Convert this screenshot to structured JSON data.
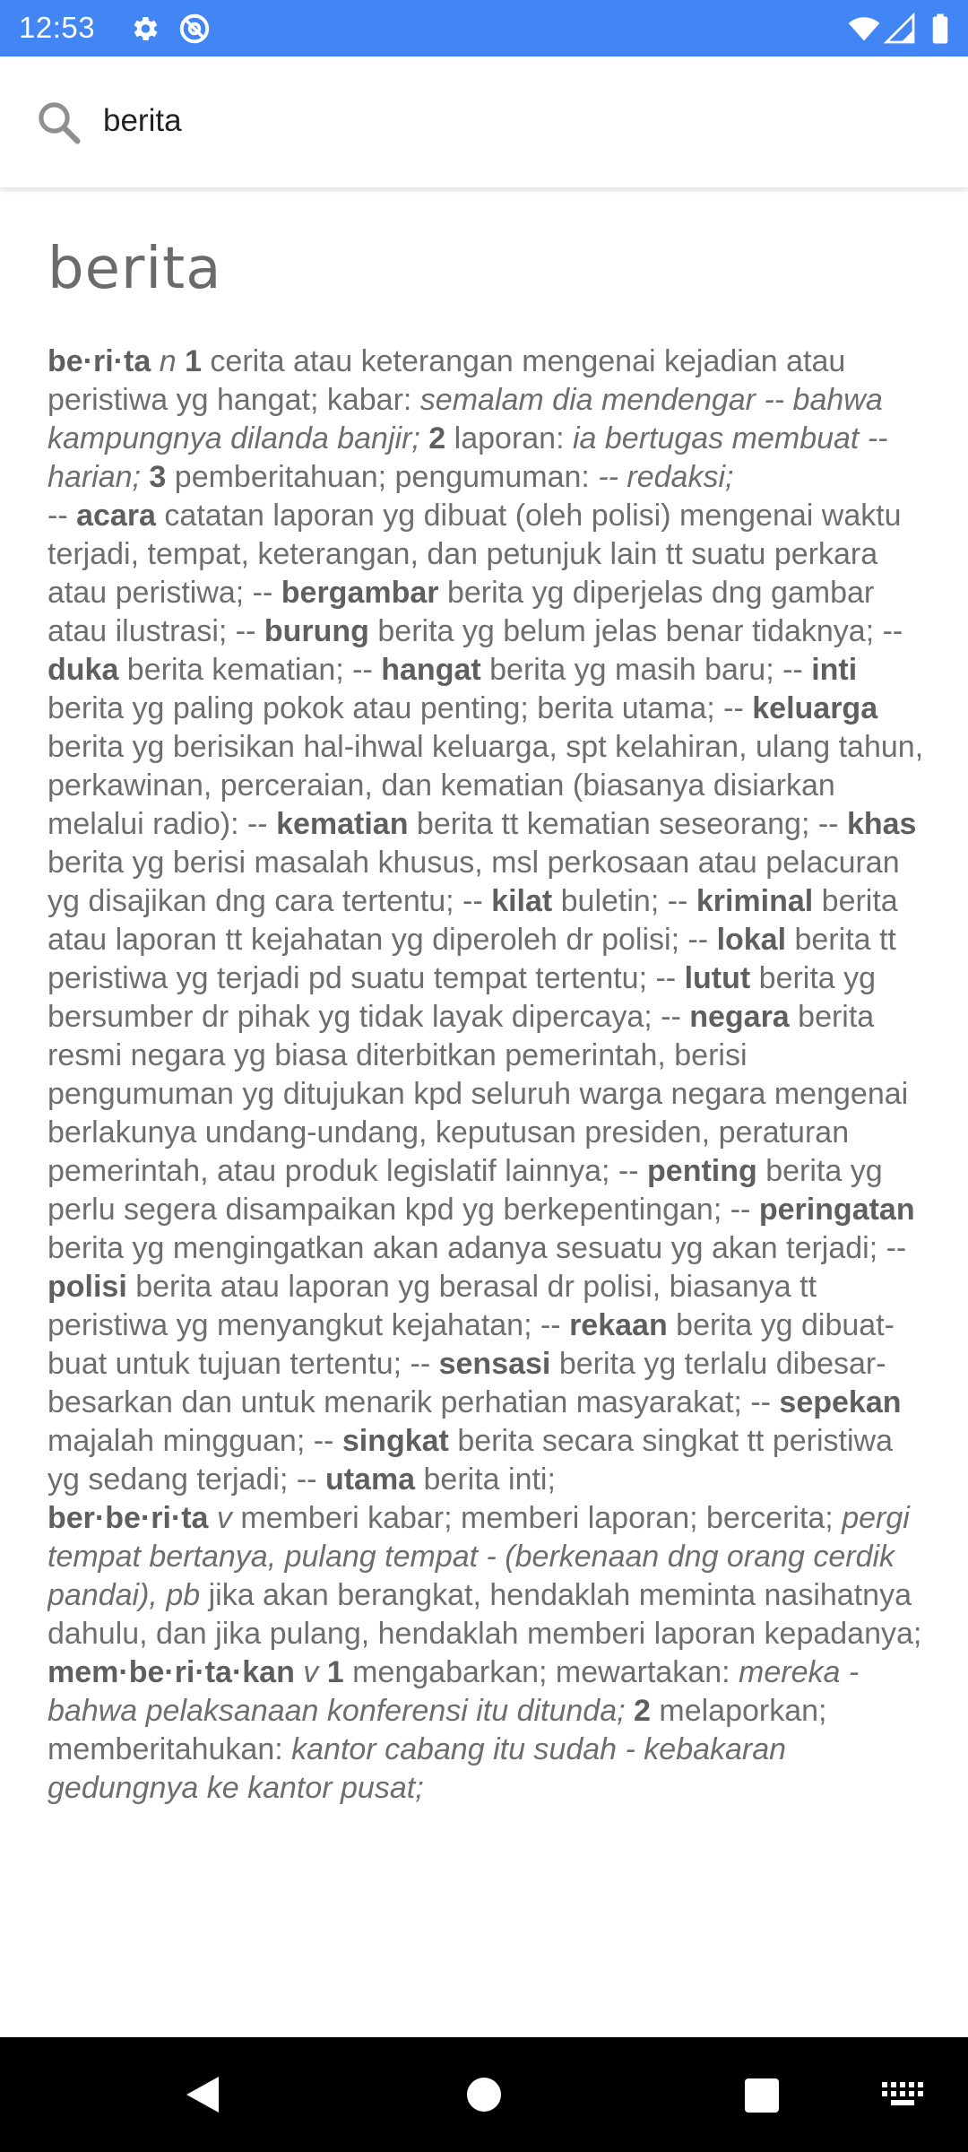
{
  "status_bar": {
    "time": "12:53",
    "background": "#4285f4",
    "icons_left": [
      "gear-icon",
      "at-sign-icon"
    ],
    "icons_right": [
      "wifi-icon",
      "signal-icon",
      "battery-icon"
    ]
  },
  "search": {
    "query": "berita",
    "placeholder": ""
  },
  "entry": {
    "title": "berita",
    "definition_html": "<p><b>be·ri·ta</b> <i>n</i> <b>1</b> cerita atau keterangan mengenai kejadian atau peristiwa yg hangat; kabar: <i>semalam dia mendengar -- bahwa kampungnya dilanda banjir;</i> <b>2</b> laporan: <i>ia bertugas membuat -- harian;</i> <b>3</b> pemberitahuan; pengumuman: <i>-- redaksi;</i></p><p>-- <b>acara</b> catatan laporan yg dibuat (oleh polisi) mengenai waktu terjadi, tempat, keterangan, dan petunjuk lain tt suatu perkara atau peristiwa; -- <b>bergambar</b> berita yg diperjelas dng gambar atau ilustrasi; -- <b>burung</b> berita yg belum jelas benar tidaknya; -- <b>duka</b> berita kematian; -- <b>hangat</b> berita yg masih baru; -- <b>inti</b> berita yg paling pokok atau penting; berita utama; -- <b>keluarga</b> berita yg berisikan hal-ihwal keluarga, spt kelahiran, ulang tahun, perkawinan, perceraian, dan kematian (biasanya disiarkan melalui radio): -- <b>kematian</b> berita tt kematian seseorang; -- <b>khas</b> berita yg berisi masalah khusus, msl perkosaan atau pelacuran yg disajikan dng cara tertentu; -- <b>kilat</b> buletin; -- <b>kriminal</b> berita atau laporan tt kejahatan yg diperoleh dr polisi; -- <b>lokal</b> berita tt peristiwa yg terjadi pd suatu tempat tertentu; -- <b>lutut</b> berita yg bersumber dr pihak yg tidak layak dipercaya; -- <b>negara</b> berita resmi negara yg biasa diterbitkan pemerintah, berisi pengumuman yg ditujukan kpd seluruh warga negara mengenai berlakunya undang-undang, keputusan presiden, peraturan pemerintah, atau produk legislatif lainnya; -- <b>penting</b> berita yg perlu segera disampaikan kpd yg berkepentingan; -- <b>peringatan</b> berita yg mengingatkan akan adanya sesuatu yg akan terjadi; -- <b>polisi</b> berita atau laporan yg berasal dr polisi, biasanya tt peristiwa yg menyangkut kejahatan; -- <b>rekaan</b> berita yg dibuat-buat untuk tujuan tertentu; -- <b>sensasi</b> berita yg terlalu dibesar-besarkan dan untuk menarik perhatian masyarakat; -- <b>sepekan</b> majalah mingguan; -- <b>singkat</b> berita secara singkat tt peristiwa yg sedang terjadi; -- <b>utama</b> berita inti;</p><p><b>ber·be·ri·ta</b> <i>v</i> memberi kabar; memberi laporan; bercerita; <i>pergi tempat bertanya, pulang tempat - (berkenaan dng orang cerdik pandai), pb</i> jika akan berangkat, hendaklah meminta nasihatnya dahulu, dan jika pulang, hendaklah memberi laporan kepadanya;</p><p><b>mem·be·ri·ta·kan</b> <i>v</i> <b>1</b> mengabarkan; mewartakan: <i>mereka - bahwa pelaksanaan konferensi itu ditunda;</i> <b>2</b> melaporkan; memberitahukan: <i>kantor cabang itu sudah - kebakaran gedungnya ke kantor pusat;</i></p>"
  },
  "navigation_bar": {
    "buttons": [
      "back-icon",
      "home-icon",
      "recents-icon",
      "keyboard-icon"
    ]
  }
}
